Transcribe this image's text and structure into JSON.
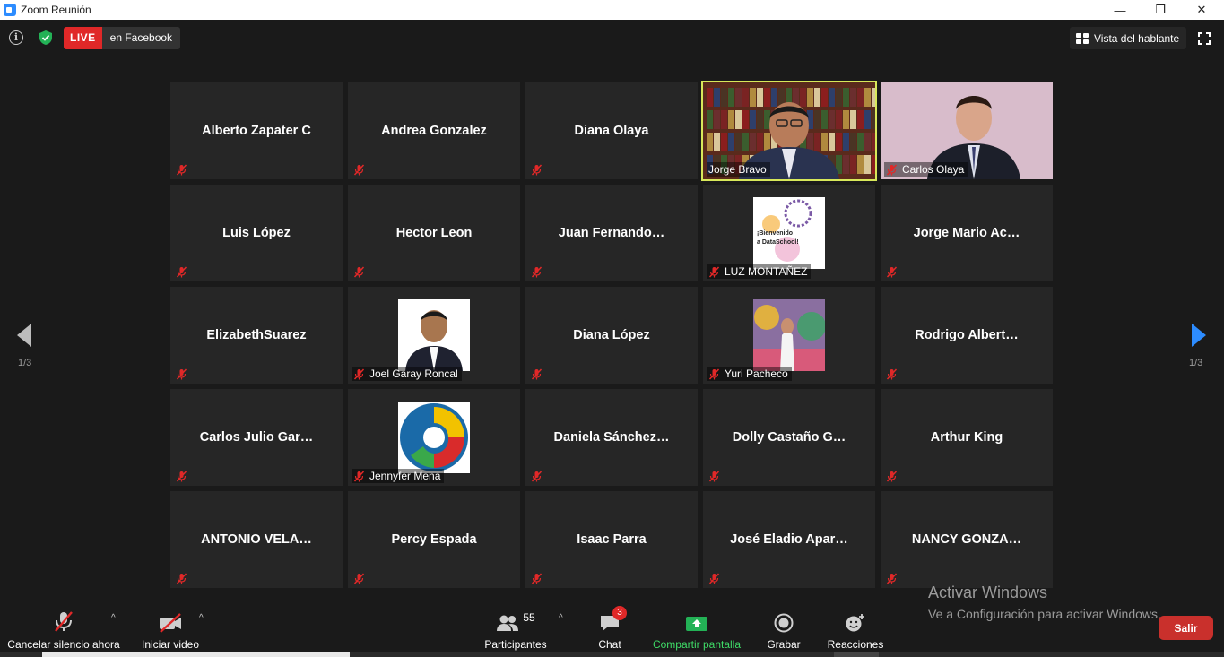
{
  "window": {
    "title": "Zoom Reunión",
    "minimize_glyph": "—",
    "restore_glyph": "❐",
    "close_glyph": "✕"
  },
  "toolbar": {
    "info_glyph": "i",
    "live_badge": "LIVE",
    "live_destination": "en Facebook",
    "view_button": "Vista del hablante"
  },
  "gallery": {
    "page_indicator": "1/3",
    "tiles": [
      {
        "name": "Alberto Zapater C",
        "type": "name"
      },
      {
        "name": "Andrea Gonzalez",
        "type": "name"
      },
      {
        "name": "Diana Olaya",
        "type": "name"
      },
      {
        "name": "Jorge Bravo",
        "type": "video",
        "active_speaker": true
      },
      {
        "name": "Carlos Olaya",
        "type": "video"
      },
      {
        "name": "Luis López",
        "type": "name"
      },
      {
        "name": "Hector Leon",
        "type": "name"
      },
      {
        "name": "Juan  Fernando…",
        "type": "name"
      },
      {
        "name": "LUZ MONTAÑEZ",
        "type": "avatar",
        "avatar_caption_1": "¡Bienvenido",
        "avatar_caption_2": "a DataSchool!"
      },
      {
        "name": "Jorge  Mario  Ac…",
        "type": "name"
      },
      {
        "name": "ElizabethSuarez",
        "type": "name"
      },
      {
        "name": "Joel Garay Roncal",
        "type": "avatar"
      },
      {
        "name": "Diana López",
        "type": "name"
      },
      {
        "name": "Yuri Pacheco",
        "type": "avatar"
      },
      {
        "name": "Rodrigo   Albert…",
        "type": "name"
      },
      {
        "name": "Carlos  Julio  Gar…",
        "type": "name"
      },
      {
        "name": "Jennyfer Mena",
        "type": "avatar"
      },
      {
        "name": "Daniela  Sánchez…",
        "type": "name"
      },
      {
        "name": "Dolly  Castaño  G…",
        "type": "name"
      },
      {
        "name": "Arthur King",
        "type": "name"
      },
      {
        "name": "ANTONIO  VELA…",
        "type": "name"
      },
      {
        "name": "Percy Espada",
        "type": "name"
      },
      {
        "name": "Isaac Parra",
        "type": "name"
      },
      {
        "name": "José  Eladio  Apar…",
        "type": "name"
      },
      {
        "name": "NANCY  GONZA…",
        "type": "name"
      }
    ]
  },
  "controls": {
    "mute": "Cancelar silencio ahora",
    "video": "Iniciar video",
    "participants": "Participantes",
    "participants_count": "55",
    "chat": "Chat",
    "chat_badge": "3",
    "share": "Compartir pantalla",
    "record": "Grabar",
    "reactions": "Reacciones",
    "exit": "Salir",
    "caret": "^"
  },
  "activation_watermark": {
    "title": "Activar Windows",
    "subtitle": "Ve a Configuración para activar Windows."
  },
  "colors": {
    "accent_blue": "#2d8cff",
    "live_red": "#e02828",
    "share_green": "#3fdb67",
    "active_speaker_outline": "#d8e85a",
    "mute_red": "#e02828"
  }
}
